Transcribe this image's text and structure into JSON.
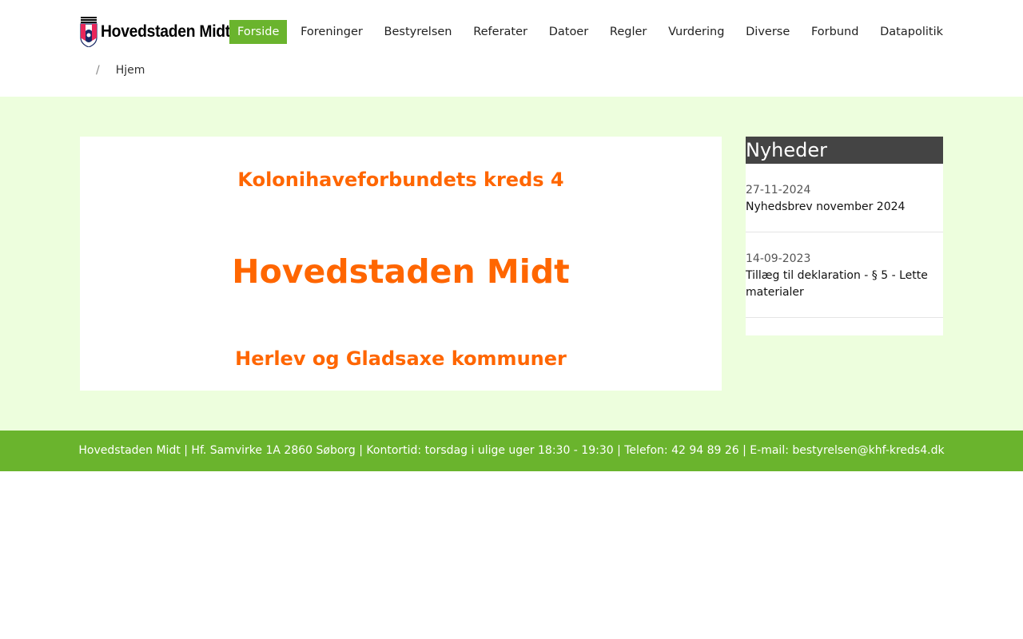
{
  "logo": {
    "text": "Hovedstaden Midt",
    "icon": "kolonihave-emblem-icon"
  },
  "nav": {
    "items": [
      {
        "label": "Forside",
        "active": true
      },
      {
        "label": "Foreninger"
      },
      {
        "label": "Bestyrelsen"
      },
      {
        "label": "Referater"
      },
      {
        "label": "Datoer"
      },
      {
        "label": "Regler"
      },
      {
        "label": "Vurdering"
      },
      {
        "label": "Diverse"
      },
      {
        "label": "Forbund"
      },
      {
        "label": "Datapolitik"
      }
    ],
    "active_color": "#6ab42d"
  },
  "breadcrumb": {
    "separator": "/",
    "current": "Hjem"
  },
  "main": {
    "subtitle": "Kolonihaveforbundets kreds 4",
    "title": "Hovedstaden Midt",
    "area": "Herlev og Gladsaxe kommuner",
    "accent_color": "#ff6600",
    "background_color": "#edfedd"
  },
  "news": {
    "heading": "Nyheder",
    "items": [
      {
        "date": "27-11-2024",
        "title": "Nyhedsbrev november 2024"
      },
      {
        "date": "14-09-2023",
        "title": "Tillæg til deklaration - § 5 - Lette materialer"
      }
    ]
  },
  "footer": {
    "text": "Hovedstaden Midt | Hf. Samvirke 1A 2860 Søborg | Kontortid: torsdag i ulige uger 18:30 - 19:30 | Telefon: 42 94 89 26 | E-mail: bestyrelsen@khf-kreds4.dk"
  }
}
